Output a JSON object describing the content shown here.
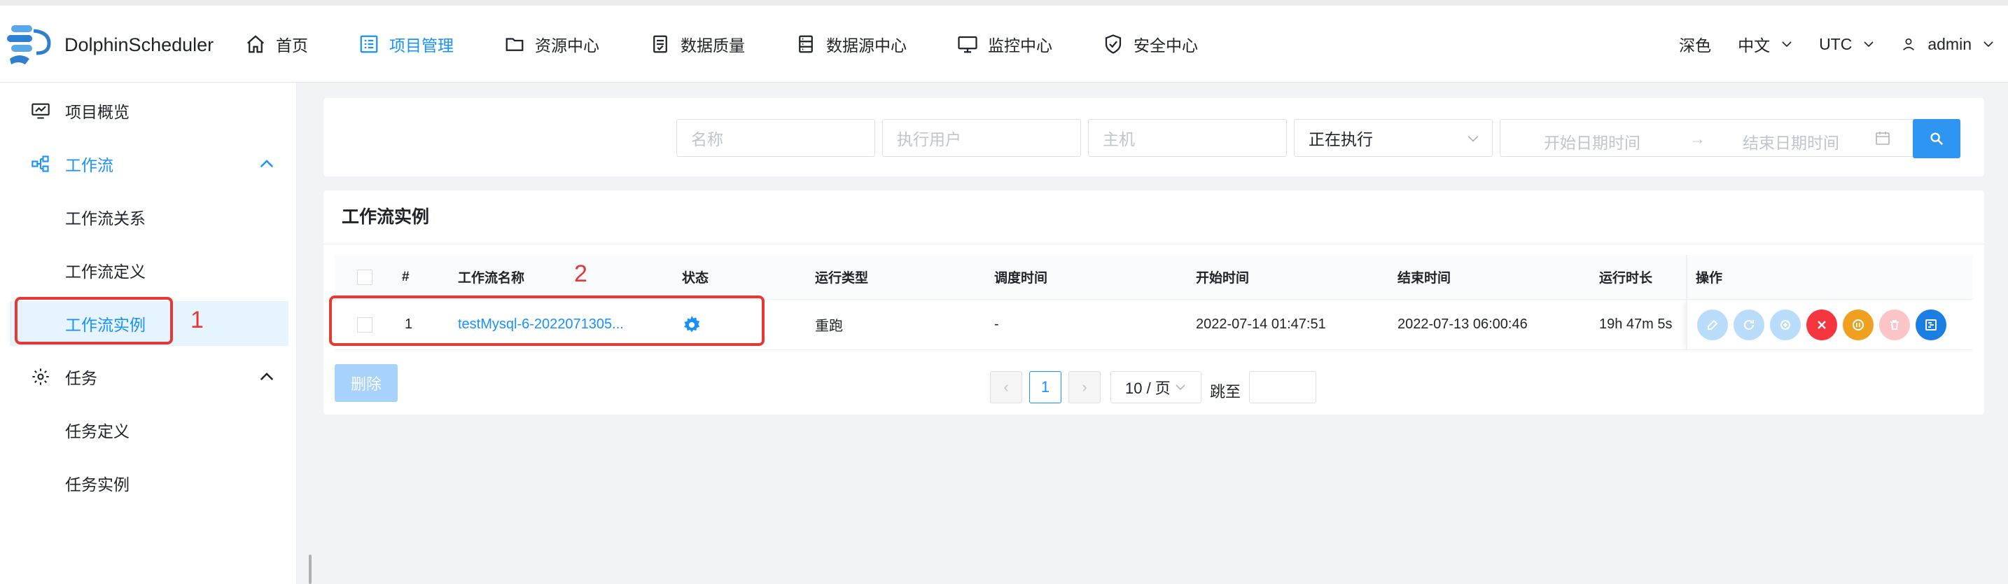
{
  "app": {
    "name": "DolphinScheduler"
  },
  "nav": [
    {
      "label": "首页",
      "icon": "home-icon"
    },
    {
      "label": "项目管理",
      "icon": "project-icon",
      "active": true
    },
    {
      "label": "资源中心",
      "icon": "folder-icon"
    },
    {
      "label": "数据质量",
      "icon": "quality-icon"
    },
    {
      "label": "数据源中心",
      "icon": "datasource-icon"
    },
    {
      "label": "监控中心",
      "icon": "monitor-icon"
    },
    {
      "label": "安全中心",
      "icon": "shield-icon"
    }
  ],
  "header_right": {
    "theme": "深色",
    "language": "中文",
    "timezone": "UTC",
    "user": "admin"
  },
  "sidebar": {
    "items": [
      {
        "label": "项目概览",
        "icon": "overview-icon"
      },
      {
        "label": "工作流",
        "icon": "workflow-icon"
      },
      {
        "label": "工作流关系"
      },
      {
        "label": "工作流定义"
      },
      {
        "label": "工作流实例"
      },
      {
        "label": "任务",
        "icon": "gear-icon"
      },
      {
        "label": "任务定义"
      },
      {
        "label": "任务实例"
      }
    ]
  },
  "filters": {
    "name_placeholder": "名称",
    "executor_placeholder": "执行用户",
    "host_placeholder": "主机",
    "state_value": "正在执行",
    "start_placeholder": "开始日期时间",
    "arrow": "→",
    "end_placeholder": "结束日期时间"
  },
  "table": {
    "title": "工作流实例",
    "columns": [
      "#",
      "工作流名称",
      "状态",
      "运行类型",
      "调度时间",
      "开始时间",
      "结束时间",
      "运行时长",
      "操作"
    ],
    "rows": [
      {
        "index": "1",
        "name": "testMysql-6-2022071305...",
        "run_type": "重跑",
        "schedule_time": "-",
        "start_time": "2022-07-14 01:47:51",
        "end_time": "2022-07-13 06:00:46",
        "duration": "19h 47m 5s"
      }
    ]
  },
  "actions": {
    "delete_label": "删除"
  },
  "pagination": {
    "prev": "‹",
    "page": "1",
    "next": "›",
    "page_size": "10 / 页",
    "jump_label": "跳至"
  },
  "annotations": {
    "marker1": "1",
    "marker2": "2"
  },
  "colors": {
    "accent": "#1890ff",
    "annotation": "#e53935"
  }
}
